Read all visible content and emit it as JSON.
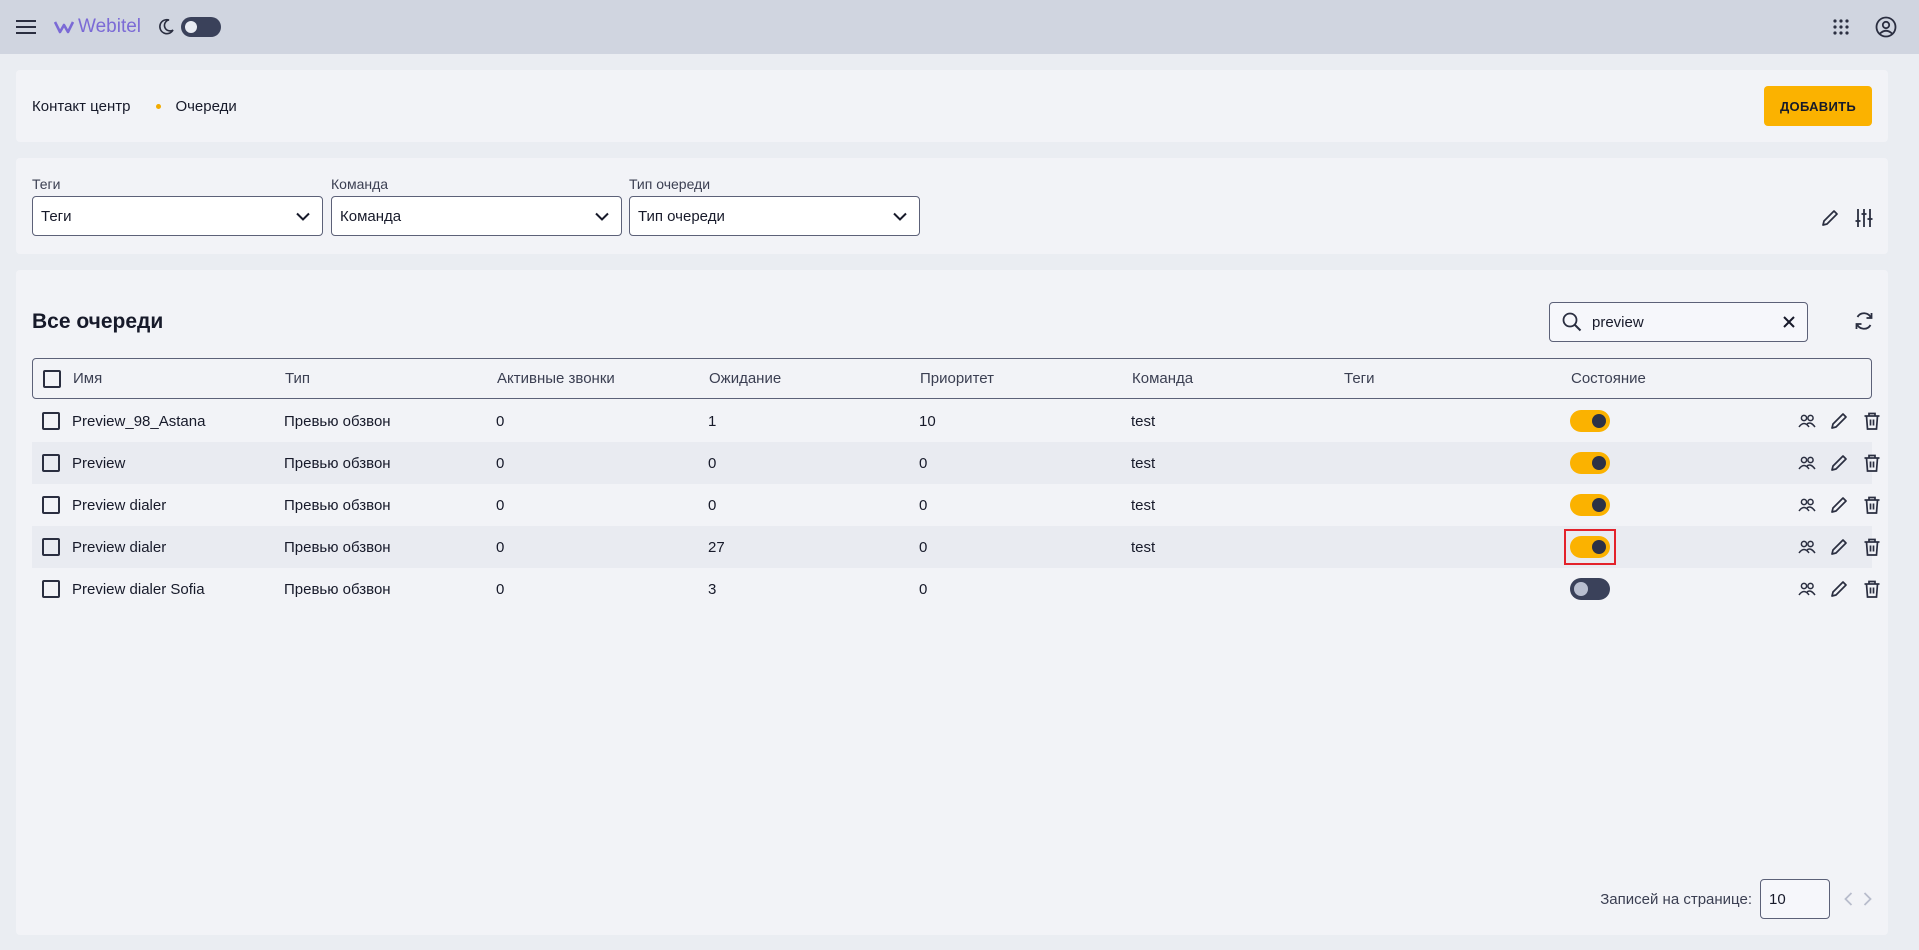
{
  "app": {
    "logo_text": "Webitel"
  },
  "breadcrumb": {
    "parent": "Контакт центр",
    "current": "Очереди"
  },
  "header": {
    "add_button": "ДОБАВИТЬ"
  },
  "filters": [
    {
      "label": "Теги",
      "value": "Теги"
    },
    {
      "label": "Команда",
      "value": "Команда"
    },
    {
      "label": "Тип очереди",
      "value": "Тип очереди"
    }
  ],
  "table": {
    "title": "Все очереди",
    "search_value": "preview",
    "columns": [
      "Имя",
      "Тип",
      "Активные звонки",
      "Ожидание",
      "Приоритет",
      "Команда",
      "Теги",
      "Состояние"
    ],
    "rows": [
      {
        "name": "Preview_98_Astana",
        "type": "Превью обзвон",
        "active": "0",
        "waiting": "1",
        "priority": "10",
        "team": "test",
        "tags": "",
        "state": true
      },
      {
        "name": "Preview",
        "type": "Превью обзвон",
        "active": "0",
        "waiting": "0",
        "priority": "0",
        "team": "test",
        "tags": "",
        "state": true
      },
      {
        "name": "Preview dialer",
        "type": "Превью обзвон",
        "active": "0",
        "waiting": "0",
        "priority": "0",
        "team": "test",
        "tags": "",
        "state": true
      },
      {
        "name": "Preview dialer",
        "type": "Превью обзвон",
        "active": "0",
        "waiting": "27",
        "priority": "0",
        "team": "test",
        "tags": "",
        "state": true
      },
      {
        "name": "Preview dialer Sofia",
        "type": "Превью обзвон",
        "active": "0",
        "waiting": "3",
        "priority": "0",
        "team": "",
        "tags": "",
        "state": false
      }
    ]
  },
  "pagination": {
    "label": "Записей на странице:",
    "per_page": "10"
  },
  "colors": {
    "accent": "#fbb200",
    "topbar": "#d0d5e0",
    "toggle_off": "#3a415a",
    "highlight": "#e3222b"
  },
  "icons": [
    "menu-icon",
    "moon-icon",
    "apps-grid-icon",
    "account-icon",
    "chevron-down-icon",
    "pencil-icon",
    "column-settings-icon",
    "search-icon",
    "clear-icon",
    "refresh-icon",
    "members-icon",
    "edit-icon",
    "delete-icon",
    "chevron-left-icon",
    "chevron-right-icon"
  ]
}
